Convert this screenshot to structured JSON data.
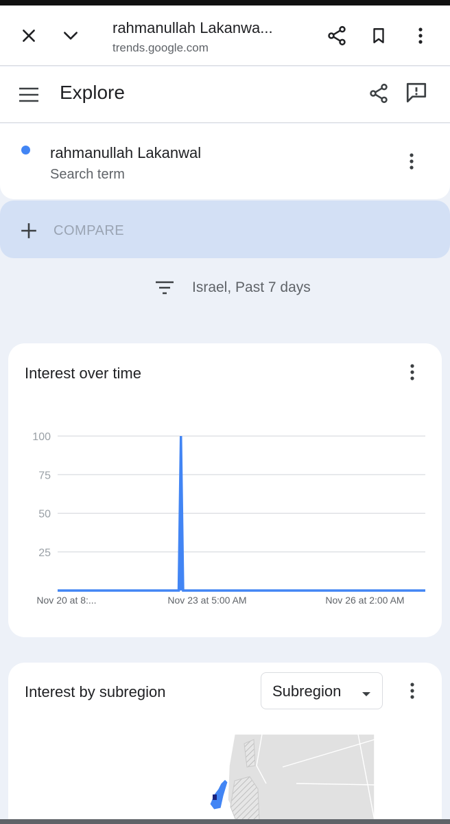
{
  "browser": {
    "page_title": "rahmanullah Lakanwa...",
    "host": "trends.google.com",
    "icons": [
      "close-icon",
      "chevron-down-icon",
      "share-icon",
      "bookmark-icon",
      "more-vert-icon"
    ]
  },
  "app_bar": {
    "title": "Explore",
    "icons": [
      "menu-icon",
      "share-icon",
      "feedback-icon"
    ]
  },
  "search_term": {
    "name": "rahmanullah Lakanwal",
    "type": "Search term",
    "color": "#4285f4"
  },
  "compare": {
    "label": "COMPARE"
  },
  "filter": {
    "label": "Israel, Past 7 days"
  },
  "interest_over_time": {
    "title": "Interest over time"
  },
  "chart_data": {
    "type": "area",
    "title": "Interest over time",
    "xlabel": "",
    "ylabel": "",
    "ylim": [
      0,
      100
    ],
    "yticks": [
      25,
      50,
      75,
      100
    ],
    "x_tick_labels": [
      "Nov 20 at 8:...",
      "Nov 23 at 5:00 AM",
      "Nov 26 at 2:00 AM"
    ],
    "grid": true,
    "series": [
      {
        "color": "#4285f4",
        "values": [
          0,
          0,
          0,
          0,
          0,
          0,
          0,
          0,
          0,
          0,
          0,
          0,
          0,
          0,
          0,
          0,
          0,
          0,
          0,
          0,
          0,
          0,
          0,
          0,
          0,
          0,
          0,
          0,
          0,
          0,
          0,
          0,
          0,
          0,
          0,
          0,
          0,
          0,
          0,
          0,
          0,
          0,
          0,
          0,
          0,
          0,
          0,
          0,
          0,
          0,
          0,
          0,
          0,
          0,
          0,
          0,
          100,
          0,
          0,
          0,
          0,
          0,
          0,
          0,
          0,
          0,
          0,
          0,
          0,
          0,
          0,
          0,
          0,
          0,
          0,
          0,
          0,
          0,
          0,
          0,
          0,
          0,
          0,
          0,
          0,
          0,
          0,
          0,
          0,
          0,
          0,
          0,
          0,
          0,
          0,
          0,
          0,
          0,
          0,
          0,
          0,
          0,
          0,
          0,
          0,
          0,
          0,
          0,
          0,
          0,
          0,
          0,
          0,
          0,
          0,
          0,
          0,
          0,
          0,
          0,
          0,
          0,
          0,
          0,
          0,
          0,
          0,
          0,
          0,
          0,
          0,
          0,
          0,
          0,
          0,
          0,
          0,
          0,
          0,
          0,
          0,
          0,
          0,
          0,
          0,
          0,
          0,
          0,
          0,
          0,
          0,
          0,
          0,
          0,
          0,
          0,
          0,
          0,
          0,
          0,
          0,
          0,
          0,
          0,
          0,
          0,
          0,
          0
        ]
      }
    ]
  },
  "interest_by_subregion": {
    "title": "Interest by subregion",
    "dropdown_value": "Subregion"
  }
}
